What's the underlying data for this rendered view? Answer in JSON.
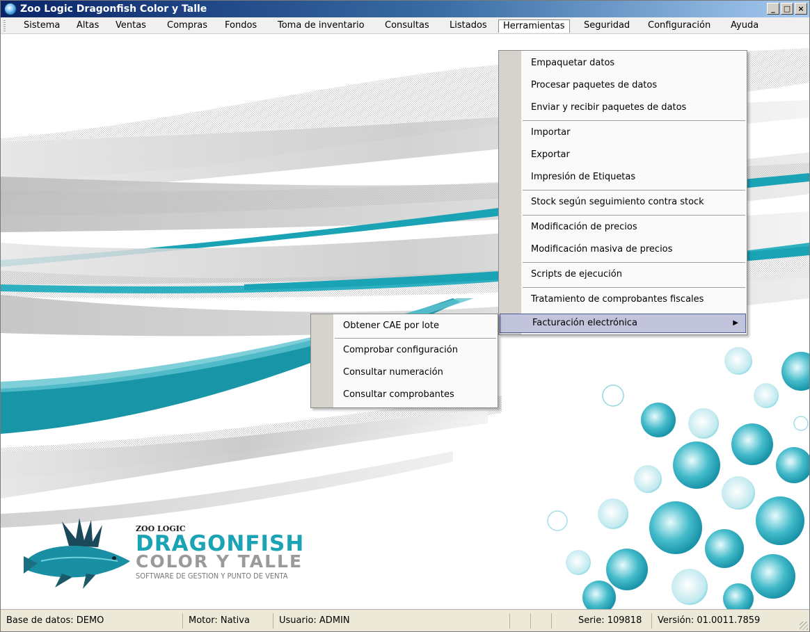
{
  "window": {
    "title": "Zoo Logic Dragonfish Color y Talle",
    "buttons": [
      "minimize",
      "maximize",
      "close"
    ]
  },
  "menubar": {
    "items": [
      {
        "label": "Sistema"
      },
      {
        "label": "Altas"
      },
      {
        "label": "Ventas"
      },
      {
        "label": "Compras"
      },
      {
        "label": "Fondos"
      },
      {
        "label": "Toma de inventario"
      },
      {
        "label": "Consultas"
      },
      {
        "label": "Listados"
      },
      {
        "label": "Herramientas",
        "active": true
      },
      {
        "label": "Seguridad"
      },
      {
        "label": "Configuración"
      },
      {
        "label": "Ayuda"
      }
    ]
  },
  "herramientas_menu": {
    "items": [
      {
        "label": "Empaquetar datos"
      },
      {
        "label": "Procesar paquetes de datos"
      },
      {
        "label": "Enviar y recibir paquetes de datos"
      },
      {
        "label": "Importar"
      },
      {
        "label": "Exportar"
      },
      {
        "label": "Impresión de Etiquetas"
      },
      {
        "label": "Stock según seguimiento contra stock"
      },
      {
        "label": "Modificación de precios"
      },
      {
        "label": "Modificación masiva de precios"
      },
      {
        "label": "Scripts de ejecución"
      },
      {
        "label": "Tratamiento de comprobantes fiscales"
      },
      {
        "label": "Facturación electrónica",
        "selected": true,
        "has_submenu": true
      }
    ]
  },
  "facturacion_submenu": {
    "items": [
      {
        "label": "Obtener CAE por lote"
      },
      {
        "label": "Comprobar configuración"
      },
      {
        "label": "Consultar numeración"
      },
      {
        "label": "Consultar comprobantes"
      }
    ]
  },
  "logo": {
    "brand": "ZOO LOGIC",
    "product": "DRAGONFISH",
    "edition": "COLOR Y TALLE",
    "tagline": "SOFTWARE DE GESTION Y PUNTO DE VENTA"
  },
  "statusbar": {
    "database": "Base de datos: DEMO",
    "engine": "Motor: Nativa",
    "user": "Usuario: ADMIN",
    "empty1": "",
    "empty2": "",
    "serial": "Serie: 109818",
    "version": "Versión: 01.0011.7859"
  },
  "colors": {
    "accent": "#1aa3b5",
    "titlebar_start": "#0a246a",
    "menu_highlight": "#c1c4da"
  }
}
